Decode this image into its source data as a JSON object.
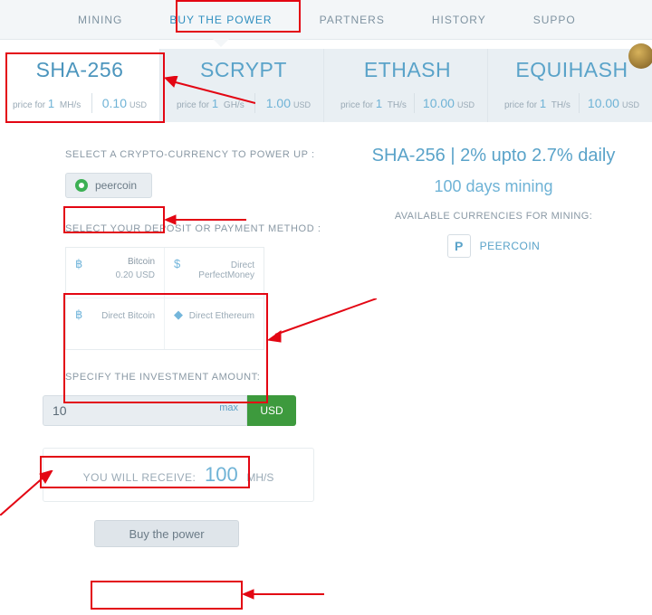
{
  "nav": {
    "items": [
      "MINING",
      "BUY THE POWER",
      "PARTNERS",
      "HISTORY",
      "SUPPO"
    ]
  },
  "algos": [
    {
      "name": "SHA-256",
      "price_label_pre": "price for",
      "price_num": "1",
      "price_unit": "MH/s",
      "price_val": "0.10",
      "currency": "USD"
    },
    {
      "name": "SCRYPT",
      "price_label_pre": "price for",
      "price_num": "1",
      "price_unit": "GH/s",
      "price_val": "1.00",
      "currency": "USD"
    },
    {
      "name": "ETHASH",
      "price_label_pre": "price for",
      "price_num": "1",
      "price_unit": "TH/s",
      "price_val": "10.00",
      "currency": "USD"
    },
    {
      "name": "EQUIHASH",
      "price_label_pre": "price for",
      "price_num": "1",
      "price_unit": "TH/s",
      "price_val": "10.00",
      "currency": "USD"
    }
  ],
  "left": {
    "select_crypto_label": "SELECT A CRYPTO-CURRENCY TO POWER UP :",
    "crypto_selected": "peercoin",
    "select_payment_label": "SELECT YOUR DEPOSIT OR PAYMENT METHOD :",
    "payments": [
      {
        "icon": "฿",
        "label": "Bitcoin",
        "sub": "0.20 USD"
      },
      {
        "icon": "$",
        "label": "",
        "sub": "Direct PerfectMoney"
      },
      {
        "icon": "฿",
        "label": "",
        "sub": "Direct Bitcoin"
      },
      {
        "icon": "◆",
        "label": "",
        "sub": "Direct Ethereum"
      }
    ],
    "specify_amount_label": "SPECIFY THE INVESTMENT AMOUNT:",
    "amount_value": "10",
    "amount_max": "max",
    "amount_unit": "USD",
    "receive_label": "YOU WILL RECEIVE:",
    "receive_value": "100",
    "receive_unit": "MH/S",
    "buy_button": "Buy the power"
  },
  "right": {
    "title": "SHA-256 | 2% upto 2.7% daily",
    "subtitle": "100 days mining",
    "avail_label": "AVAILABLE CURRENCIES FOR MINING:",
    "avail_coin_initial": "P",
    "avail_coin_name": "PEERCOIN"
  }
}
